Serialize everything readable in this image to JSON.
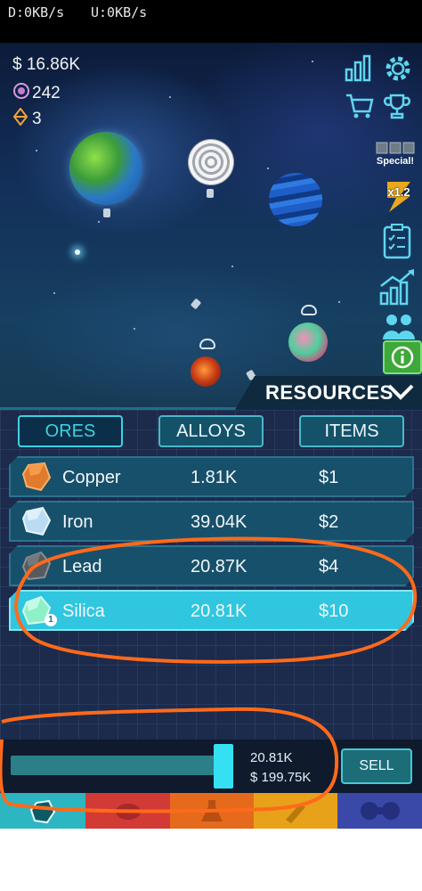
{
  "status_bar": {
    "download": "D:0KB/s",
    "upload": "U:0KB/s"
  },
  "currencies": [
    {
      "icon": "dollar-icon",
      "value": "$ 16.86K"
    },
    {
      "icon": "dark-matter-icon",
      "value": "242"
    },
    {
      "icon": "gem-icon",
      "value": "3"
    }
  ],
  "side_buttons": {
    "special_label": "Special!",
    "boost_label": "x1.2"
  },
  "resources": {
    "title": "RESOURCES",
    "tabs": [
      {
        "label": "ORES",
        "active": true
      },
      {
        "label": "ALLOYS",
        "active": false
      },
      {
        "label": "ITEMS",
        "active": false
      }
    ],
    "rows": [
      {
        "name": "Copper",
        "amount": "1.81K",
        "price": "$1",
        "selected": false,
        "color": "#e07a2c"
      },
      {
        "name": "Iron",
        "amount": "39.04K",
        "price": "$2",
        "selected": false,
        "color": "#b9dcf2"
      },
      {
        "name": "Lead",
        "amount": "20.87K",
        "price": "$4",
        "selected": false,
        "color": "#555a5f"
      },
      {
        "name": "Silica",
        "amount": "20.81K",
        "price": "$10",
        "selected": true,
        "color": "#8ef0c6",
        "badge": "1"
      }
    ]
  },
  "sell_panel": {
    "quantity": "20.81K",
    "value": "$ 199.75K",
    "sell_label": "SELL",
    "slider_fraction": 1.0
  },
  "bottom_nav": [
    {
      "name": "tab-ores",
      "color": "#2bb6c2"
    },
    {
      "name": "tab-smelting",
      "color": "#d23a36"
    },
    {
      "name": "tab-crafting",
      "color": "#e56a1c"
    },
    {
      "name": "tab-projects",
      "color": "#e8a21a"
    },
    {
      "name": "tab-research",
      "color": "#3a48a8"
    }
  ],
  "colors": {
    "accent": "#3fd1e2",
    "annotation": "#ff6a1a"
  }
}
